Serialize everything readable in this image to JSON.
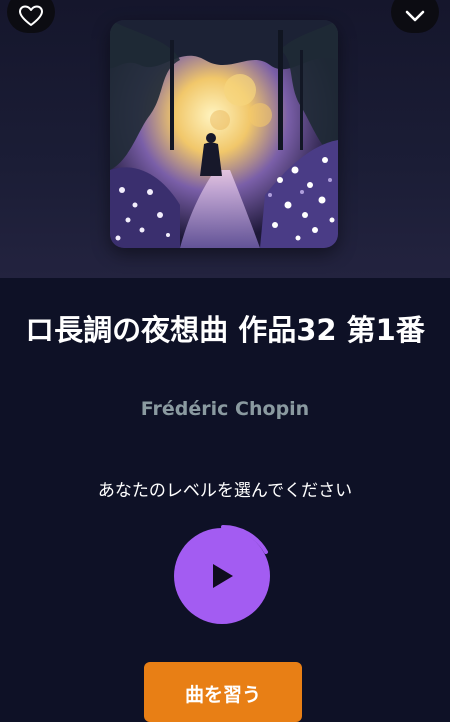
{
  "header": {
    "favorite_icon": "heart-outline-icon",
    "collapse_icon": "chevron-down-icon"
  },
  "piece": {
    "title": "ロ長調の夜想曲 作品32 第1番",
    "composer": "Frédéric Chopin"
  },
  "level": {
    "prompt": "あなたのレベルを選んでください",
    "play_icon": "play-icon"
  },
  "actions": {
    "learn_label": "曲を習う"
  },
  "colors": {
    "background": "#0e1126",
    "accent_purple": "#a35cf2",
    "button_orange": "#e87f15",
    "composer_text": "#8a9aa0"
  }
}
